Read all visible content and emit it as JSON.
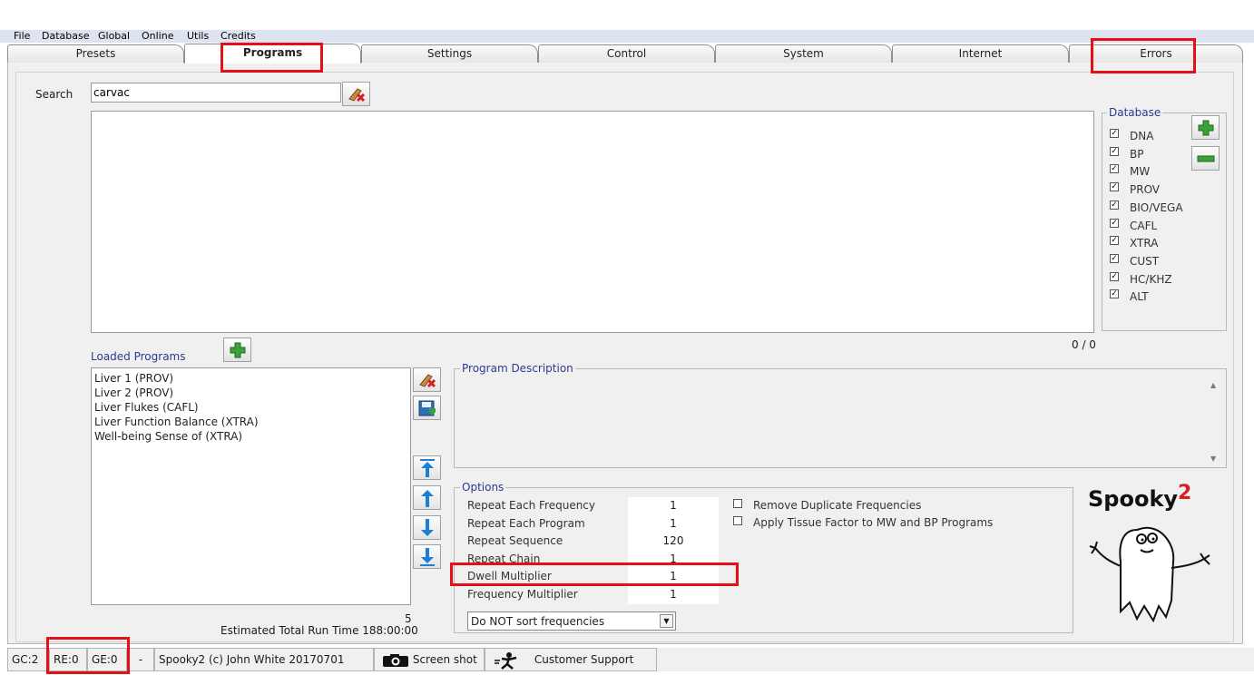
{
  "menu": [
    "File",
    "Database",
    "Global",
    "Online",
    "Utils",
    "Credits"
  ],
  "tabs": [
    {
      "label": "Presets"
    },
    {
      "label": "Programs"
    },
    {
      "label": "Settings"
    },
    {
      "label": "Control"
    },
    {
      "label": "System"
    },
    {
      "label": "Internet"
    },
    {
      "label": "Errors"
    }
  ],
  "search": {
    "label": "Search",
    "value": "carvac"
  },
  "results_count": "0 / 0",
  "database": {
    "title": "Database",
    "items": [
      {
        "label": "DNA",
        "checked": true
      },
      {
        "label": "BP",
        "checked": true
      },
      {
        "label": "MW",
        "checked": true
      },
      {
        "label": "PROV",
        "checked": true
      },
      {
        "label": "BIO/VEGA",
        "checked": true
      },
      {
        "label": "CAFL",
        "checked": true
      },
      {
        "label": "XTRA",
        "checked": true
      },
      {
        "label": "CUST",
        "checked": true
      },
      {
        "label": "HC/KHZ",
        "checked": true
      },
      {
        "label": "ALT",
        "checked": true
      }
    ]
  },
  "loaded_programs": {
    "title": "Loaded Programs",
    "items": [
      "Liver 1 (PROV)",
      "Liver 2 (PROV)",
      "Liver Flukes (CAFL)",
      "Liver Function Balance (XTRA)",
      "Well-being Sense of (XTRA)"
    ],
    "count": "5",
    "run_time": "Estimated Total Run Time 188:00:00"
  },
  "program_description": {
    "title": "Program Description"
  },
  "options": {
    "title": "Options",
    "rows": [
      {
        "label": "Repeat Each Frequency",
        "value": "1"
      },
      {
        "label": "Repeat Each Program",
        "value": "1"
      },
      {
        "label": "Repeat Sequence",
        "value": "120"
      },
      {
        "label": "Repeat Chain",
        "value": "1"
      },
      {
        "label": "Dwell Multiplier",
        "value": "1"
      },
      {
        "label": "Frequency Multiplier",
        "value": "1"
      }
    ],
    "checks": [
      {
        "label": "Remove Duplicate Frequencies",
        "checked": false
      },
      {
        "label": "Apply Tissue Factor to MW and BP Programs",
        "checked": false
      }
    ],
    "sort_select": "Do NOT sort frequencies"
  },
  "logo": {
    "text": "Spooky",
    "superscript": "2"
  },
  "status": {
    "gc": "GC:2",
    "re": "RE:0",
    "ge": "GE:0",
    "dash": "-",
    "copyright": "Spooky2 (c) John White 20170701",
    "screenshot": "Screen shot",
    "support": "Customer Support"
  },
  "colors": {
    "highlight": "#e3101a",
    "accent_text": "#2b3a8f",
    "add_icon": "#3aa23a",
    "arrow_icon": "#1e7fd6"
  }
}
